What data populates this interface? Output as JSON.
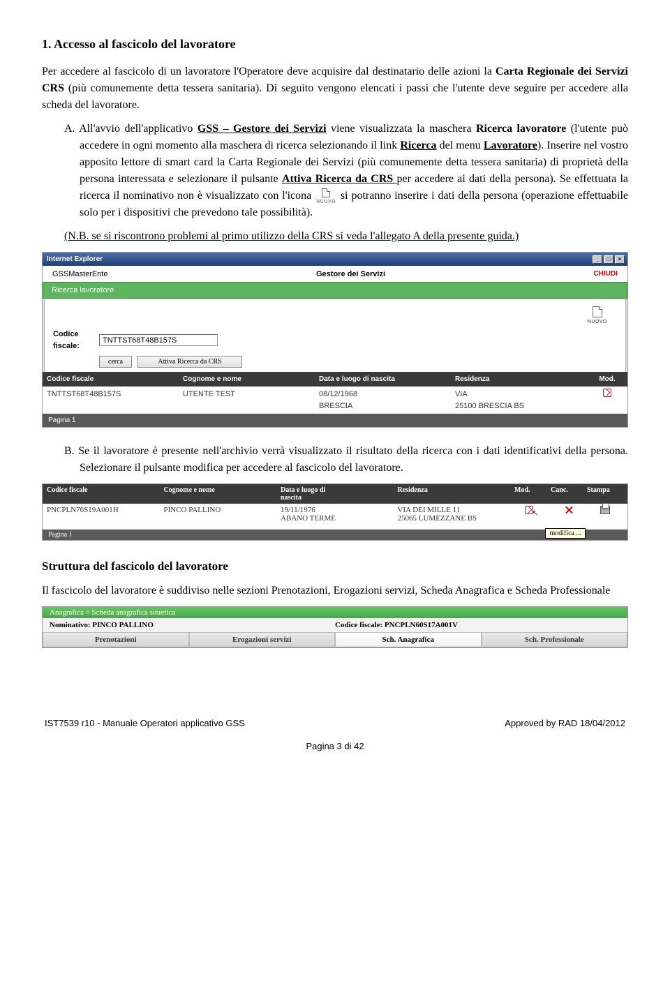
{
  "section1": {
    "title": "1. Accesso al fascicolo del lavoratore",
    "intro_a": "Per accedere al fascicolo di un lavoratore l'Operatore deve acquisire dal destinatario delle azioni la ",
    "intro_b": "Carta Regionale dei Servizi CRS",
    "intro_c": " (più comunemente detta tessera sanitaria). Di seguito vengono elencati i passi che l'utente deve seguire per accedere alla scheda del lavoratore.",
    "A_pre": "A. All'avvio dell'applicativo ",
    "A_u1": "GSS – Gestore dei Servizi",
    "A_mid1": " viene visualizzata la maschera ",
    "A_b1": "Ricerca lavoratore",
    "A_mid2": " (l'utente può accedere in ogni momento alla maschera di ricerca selezionando il link ",
    "A_u2": "Ricerca",
    "A_mid3": " del menu ",
    "A_u3": "Lavoratore",
    "A_mid4": "). Inserire nel vostro apposito lettore di smart card la Carta Regionale dei Servizi (più comunemente detta tessera sanitaria) di proprietà della persona interessata e selezionare il pulsante ",
    "A_u4": "Attiva Ricerca da CRS ",
    "A_mid5": "per accedere ai dati della persona). Se effettuata la ricerca il nominativo non è visualizzato con l'icona ",
    "A_mid6": " si potranno inserire i dati della persona (operazione effettuabile solo per i dispositivi che prevedono tale possibilità).",
    "A_nb": "(N.B. se si riscontrono problemi al primo utilizzo della CRS si veda l'allegato A della presente guida.)"
  },
  "window1": {
    "title_left": "Internet Explorer",
    "app_brand": "GSSMasterEnte",
    "app_mid": "Gestore dei Servizi",
    "app_close": "CHIUDI",
    "green": "Ricerca lavoratore",
    "nuovo": "NUOVO",
    "label_cf": "Codice fiscale:",
    "value_cf": "TNTTST68T48B157S",
    "btn_cerca": "cerca",
    "btn_crs": "Attiva Ricerca da CRS",
    "hdr": [
      "Codice fiscale",
      "Cognome e nome",
      "Data e luogo di nascita",
      "Residenza",
      "Mod."
    ],
    "row": [
      "TNTTST68T48B157S",
      "UTENTE TEST",
      "08/12/1968\nBRESCIA",
      "VIA\n25100 BRESCIA BS",
      ""
    ],
    "pagina": "Pagina 1"
  },
  "B": {
    "pre": "B. ",
    "text": "Se il lavoratore è presente nell'archivio verrà visualizzato il risultato della ricerca con i dati identificativi della persona. Selezionare il pulsante modifica per accedere al fascicolo del lavoratore."
  },
  "window2": {
    "hdr": [
      "Codice fiscale",
      "Cognome e nome",
      "Data e luogo di\nnascita",
      "Residenza",
      "Mod.",
      "Canc.",
      "Stampa"
    ],
    "row": [
      "PNCPLN76S19A001H",
      "PINCO PALLINO",
      "19/11/1976\nABANO TERME",
      "VIA DEI MILLE 11\n25065 LUMEZZANE BS"
    ],
    "pagina": "Pagina 1",
    "tooltip": "modifica ..."
  },
  "struttura": {
    "h": "Struttura del fascicolo del lavoratore",
    "p": "Il fascicolo del lavoratore è suddiviso nelle sezioni Prenotazioni, Erogazioni servizi, Scheda Anagrafica e Scheda Professionale"
  },
  "ana": {
    "crumb": "Anagrafica >  Scheda anagrafica sintetica",
    "nom_label": "Nominativo: ",
    "nom": "PINCO  PALLINO",
    "cf_label": "Codice fiscale: ",
    "cf": "PNCPLN60S17A001V",
    "tabs": [
      "Prenotazioni",
      "Erogazioni servizi",
      "Sch. Anagrafica",
      "Sch. Professionale"
    ]
  },
  "footer": {
    "left": "IST7539 r10 -  Manuale Operatori applicativo GSS",
    "right": "Approved by RAD 18/04/2012",
    "center": "Pagina 3 di 42"
  }
}
